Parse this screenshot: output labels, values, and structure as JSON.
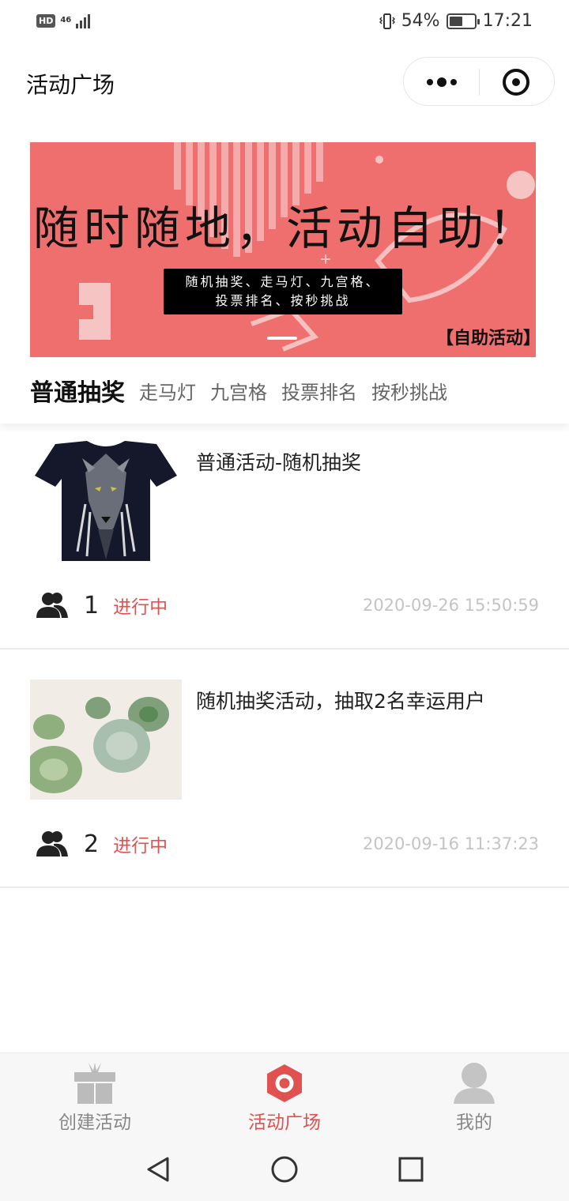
{
  "status_bar": {
    "hd": "HD",
    "network": "46",
    "battery_percent": "54%",
    "battery_level": 0.54,
    "time": "17:21"
  },
  "nav": {
    "title": "活动广场",
    "more_icon": "more-dots-icon",
    "close_icon": "target-close-icon"
  },
  "banner": {
    "heading": "随时随地，活动自助！",
    "subtitle_line1": "随机抽奖、走马灯、九宫格、",
    "subtitle_line2": "投票排名、按秒挑战",
    "tag": "【自助活动】",
    "background_color": "#ef6f6f"
  },
  "tabs": [
    {
      "label": "普通抽奖",
      "active": true
    },
    {
      "label": "走马灯",
      "active": false
    },
    {
      "label": "九宫格",
      "active": false
    },
    {
      "label": "投票排名",
      "active": false
    },
    {
      "label": "按秒挑战",
      "active": false
    }
  ],
  "activities": [
    {
      "title": "普通活动-随机抽奖",
      "count": "1",
      "status": "进行中",
      "time": "2020-09-26 15:50:59",
      "image_icon": "wolf-tshirt-image"
    },
    {
      "title": "随机抽奖活动，抽取2名幸运用户",
      "count": "2",
      "status": "进行中",
      "time": "2020-09-16 11:37:23",
      "image_icon": "succulent-plants-image"
    }
  ],
  "bottom_tabs": [
    {
      "label": "创建活动",
      "icon": "gift-icon",
      "active": false
    },
    {
      "label": "活动广场",
      "icon": "hexagon-icon",
      "active": true
    },
    {
      "label": "我的",
      "icon": "user-icon",
      "active": false
    }
  ],
  "colors": {
    "accent": "#e0524f",
    "muted": "#888888",
    "time": "#c4c4c4"
  }
}
